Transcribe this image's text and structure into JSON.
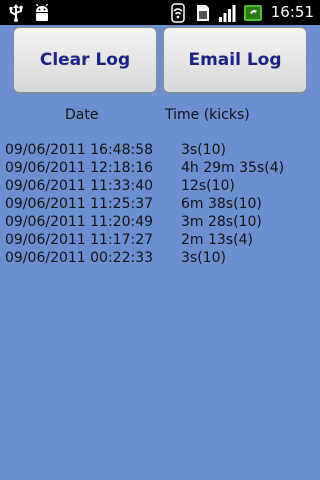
{
  "status_bar": {
    "time": "16:51",
    "icons": [
      "usb-icon",
      "android-debug-icon",
      "wifi-icon",
      "sd-card-icon",
      "signal-icon",
      "battery-charging-icon"
    ]
  },
  "buttons": {
    "clear_label": "Clear Log",
    "email_label": "Email Log"
  },
  "table": {
    "headers": {
      "date": "Date",
      "time": "Time (kicks)"
    },
    "rows": [
      {
        "date": "09/06/2011 16:48:58",
        "time": "3s(10)"
      },
      {
        "date": "09/06/2011 12:18:16",
        "time": "4h 29m 35s(4)"
      },
      {
        "date": "09/06/2011 11:33:40",
        "time": "12s(10)"
      },
      {
        "date": "09/06/2011 11:25:37",
        "time": "6m 38s(10)"
      },
      {
        "date": "09/06/2011 11:20:49",
        "time": "3m 28s(10)"
      },
      {
        "date": "09/06/2011 11:17:27",
        "time": "2m 13s(4)"
      },
      {
        "date": "09/06/2011 00:22:33",
        "time": "3s(10)"
      }
    ]
  },
  "colors": {
    "background": "#6b8fcf",
    "button_text": "#1a2388",
    "battery": "#4fbf2a"
  }
}
